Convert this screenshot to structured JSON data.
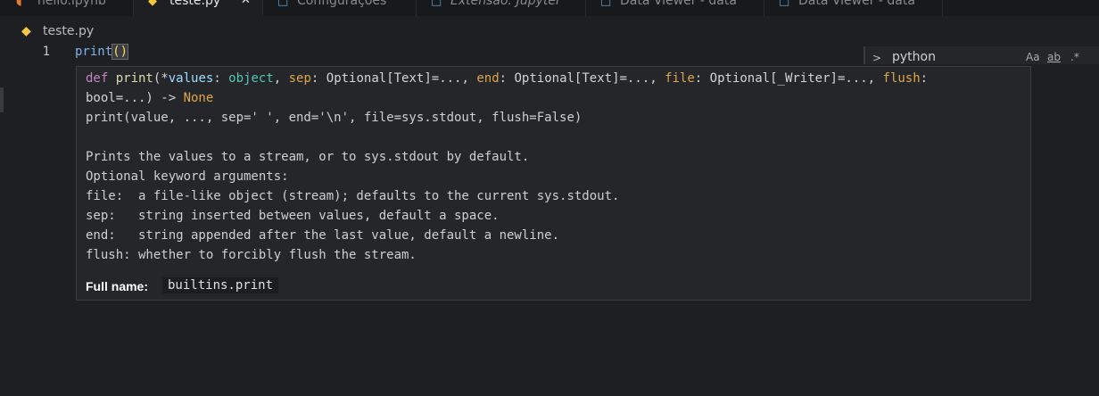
{
  "tabs": [
    {
      "label": "hello.ipynb",
      "icon": "jupyter-icon"
    },
    {
      "label": "teste.py",
      "icon": "python-icon",
      "active": true,
      "close": "✕"
    },
    {
      "label": "Configurações",
      "icon": "file-icon"
    },
    {
      "label": "Extensão: Jupyter",
      "icon": "file-icon",
      "italic": true
    },
    {
      "label": "Data Viewer - data",
      "icon": "file-icon"
    },
    {
      "label": "Data Viewer - data",
      "icon": "file-icon"
    }
  ],
  "breadcrumb": {
    "file": "teste.py",
    "icon": "python-icon"
  },
  "editor": {
    "line_number": "1",
    "code_fn": "print",
    "code_parens": "()"
  },
  "find_widget": {
    "chevron": ">",
    "query": "python",
    "match_case": "Aa",
    "whole_word": "ab",
    "regex": ".*"
  },
  "hover": {
    "sig1": {
      "def": "def ",
      "name": "print",
      "p1": "(*",
      "values": "values",
      "c1": ": ",
      "object": "object",
      "c2": ", ",
      "sep": "sep",
      "c3": ": Optional[Text]=..., ",
      "end": "end",
      "c4": ": Optional[Text]=..., ",
      "file": "file",
      "c5": ": Optional[_Writer]=..., ",
      "flush": "flush",
      "c6": ":"
    },
    "sig2": {
      "bool": "bool=...) -> ",
      "none": "None"
    },
    "usage": "print(value, ..., sep=' ', end='\\n', file=sys.stdout, flush=False)",
    "doc_lines": [
      "Prints the values to a stream, or to sys.stdout by default.",
      "Optional keyword arguments:",
      "file:  a file-like object (stream); defaults to the current sys.stdout.",
      "sep:   string inserted between values, default a space.",
      "end:   string appended after the last value, default a newline.",
      "flush: whether to forcibly flush the stream."
    ],
    "full_name_label": "Full name:",
    "full_name_value": "builtins.print"
  },
  "colors": {
    "background": "#1e1f22",
    "hover_bg": "#25262a",
    "keyword": "#c586c0",
    "function": "#dcdcaa",
    "parameter": "#9cdcfe",
    "type": "#4ec9b0"
  }
}
